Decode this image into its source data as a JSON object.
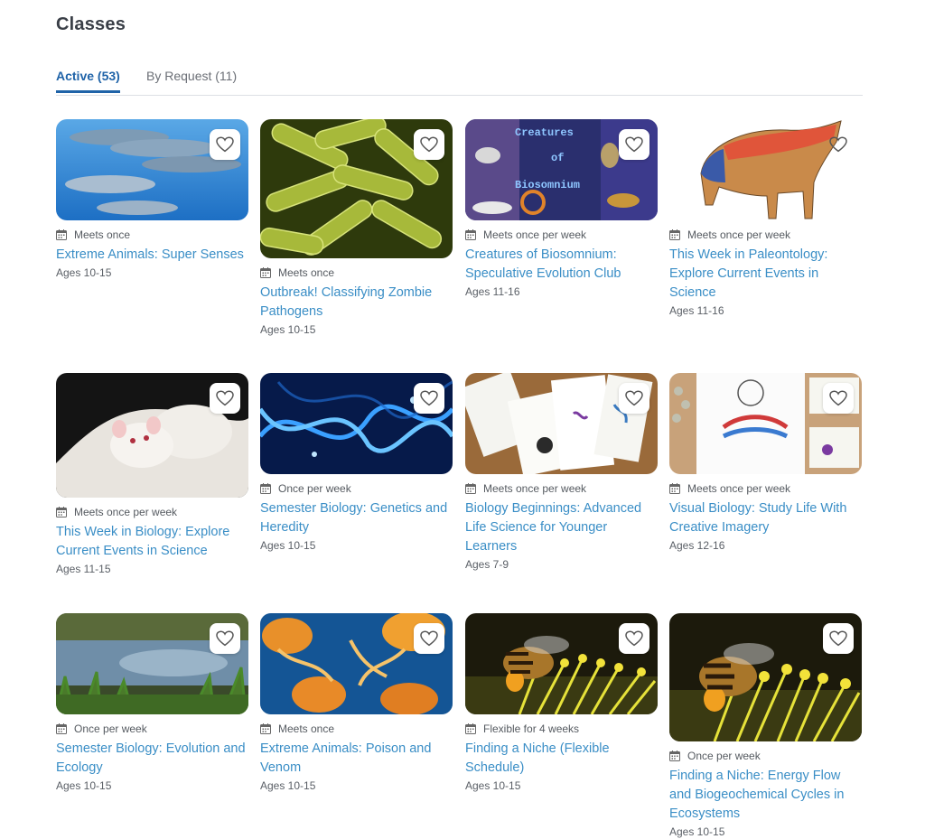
{
  "page": {
    "title": "Classes"
  },
  "tabs": [
    {
      "label": "Active (53)",
      "active": true
    },
    {
      "label": "By Request (11)",
      "active": false
    }
  ],
  "icons": {
    "favorite": "heart-outline-icon",
    "schedule": "calendar-icon"
  },
  "colors": {
    "link": "#3a8ec6",
    "active_tab": "#1f63a8",
    "title": "#3a3f47"
  },
  "cards": [
    {
      "schedule": "Meets once",
      "title": "Extreme Animals: Super Senses",
      "ages": "Ages 10-15",
      "image": "dolphins"
    },
    {
      "schedule": "Meets once",
      "title": "Outbreak! Classifying Zombie Pathogens",
      "ages": "Ages 10-15",
      "image": "bacteria"
    },
    {
      "schedule": "Meets once per week",
      "title": "Creatures of Biosomnium: Speculative Evolution Club",
      "ages": "Ages 11-16",
      "image": "creatures-of-biosomnium",
      "image_text": [
        "Creatures",
        "of",
        "Biosomnium"
      ]
    },
    {
      "schedule": "Meets once per week",
      "title": "This Week in Paleontology: Explore Current Events in Science",
      "ages": "Ages 11-16",
      "image": "dinosaur-drawing"
    },
    {
      "schedule": "Meets once per week",
      "title": "This Week in Biology: Explore Current Events in Science",
      "ages": "Ages 11-15",
      "image": "white-mouse"
    },
    {
      "schedule": "Once per week",
      "title": "Semester Biology: Genetics and Heredity",
      "ages": "Ages 10-15",
      "image": "dna-helix"
    },
    {
      "schedule": "Meets once per week",
      "title": "Biology Beginnings: Advanced Life Science for Younger Learners",
      "ages": "Ages 7-9",
      "image": "bacteria-cards"
    },
    {
      "schedule": "Meets once per week",
      "title": "Visual Biology: Study Life With Creative Imagery",
      "ages": "Ages 12-16",
      "image": "body-diagram"
    },
    {
      "schedule": "Once per week",
      "title": "Semester Biology: Evolution and Ecology",
      "ages": "Ages 10-15",
      "image": "pond"
    },
    {
      "schedule": "Meets once",
      "title": "Extreme Animals: Poison and Venom",
      "ages": "Ages 10-15",
      "image": "jellyfish"
    },
    {
      "schedule": "Flexible for 4 weeks",
      "title": "Finding a Niche (Flexible Schedule)",
      "ages": "Ages 10-15",
      "image": "bee"
    },
    {
      "schedule": "Once per week",
      "title": "Finding a Niche: Energy Flow and Biogeochemical Cycles in Ecosystems",
      "ages": "Ages 10-15",
      "image": "bee"
    }
  ]
}
